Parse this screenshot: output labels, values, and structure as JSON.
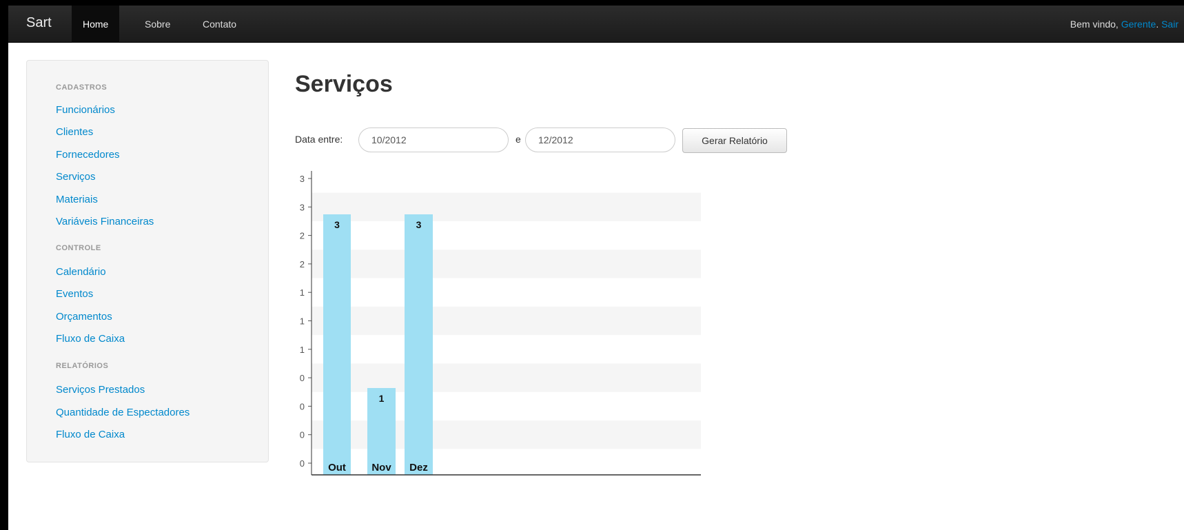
{
  "navbar": {
    "brand": "Sart",
    "items": [
      "Home",
      "Sobre",
      "Contato"
    ],
    "welcome_prefix": "Bem vindo, ",
    "user": "Gerente",
    "separator": ". ",
    "logout": "Sair"
  },
  "sidebar": {
    "sections": [
      {
        "header": "CADASTROS",
        "links": [
          "Funcionários",
          "Clientes",
          "Fornecedores",
          "Serviços",
          "Materiais",
          "Variáveis Financeiras"
        ]
      },
      {
        "header": "CONTROLE",
        "links": [
          "Calendário",
          "Eventos",
          "Orçamentos",
          "Fluxo de Caixa"
        ]
      },
      {
        "header": "RELATÓRIOS",
        "links": [
          "Serviços Prestados",
          "Quantidade de Espectadores",
          "Fluxo de Caixa"
        ]
      }
    ]
  },
  "main": {
    "title": "Serviços",
    "filter_label": "Data entre:",
    "date_from": "10/2012",
    "between": "e",
    "date_to": "12/2012",
    "button": "Gerar Relatório"
  },
  "colors": {
    "bar": "#9fdff3",
    "link": "#0088cc",
    "navbar": "#1b1b1b"
  },
  "chart_data": {
    "type": "bar",
    "categories": [
      "Out",
      "Nov",
      "Dez"
    ],
    "values": [
      3,
      1,
      3
    ],
    "y_tick_labels": [
      "3",
      "3",
      "2",
      "2",
      "1",
      "1",
      "1",
      "0",
      "0",
      "0",
      "0"
    ],
    "ylim": [
      0,
      3.5
    ],
    "title": "",
    "xlabel": "",
    "ylabel": "",
    "grid": "horizontal bands"
  }
}
